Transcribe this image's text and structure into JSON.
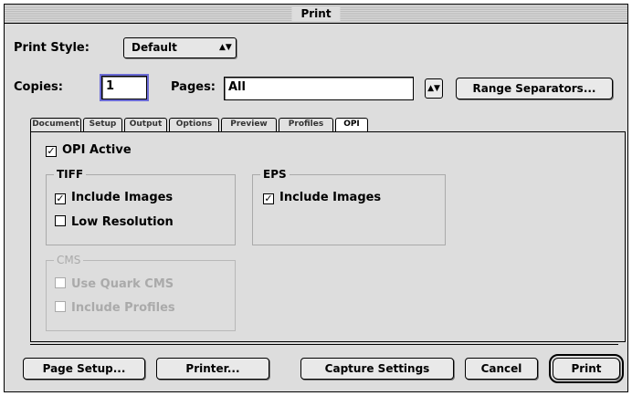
{
  "window": {
    "title": "Print"
  },
  "print_style": {
    "label": "Print Style:",
    "value": "Default"
  },
  "copies": {
    "label": "Copies:",
    "value": "1"
  },
  "pages": {
    "label": "Pages:",
    "value": "All"
  },
  "range_separators_label": "Range Separators...",
  "tabs": [
    "Document",
    "Setup",
    "Output",
    "Options",
    "Preview",
    "Profiles",
    "OPI"
  ],
  "active_tab": "OPI",
  "opi": {
    "opi_active": {
      "label": "OPI Active",
      "checked": true
    },
    "tiff": {
      "title": "TIFF",
      "include_images": {
        "label": "Include Images",
        "checked": true
      },
      "low_resolution": {
        "label": "Low Resolution",
        "checked": false
      }
    },
    "eps": {
      "title": "EPS",
      "include_images": {
        "label": "Include Images",
        "checked": true
      }
    },
    "cms": {
      "title": "CMS",
      "use_quark_cms": {
        "label": "Use Quark CMS",
        "checked": false,
        "enabled": false
      },
      "include_profiles": {
        "label": "Include Profiles",
        "checked": false,
        "enabled": false
      }
    }
  },
  "buttons": {
    "page_setup": "Page Setup...",
    "printer": "Printer...",
    "capture_settings": "Capture Settings",
    "cancel": "Cancel",
    "print": "Print"
  },
  "glyphs": {
    "popup_arrows": "▲▼",
    "checkmark": "✓"
  }
}
